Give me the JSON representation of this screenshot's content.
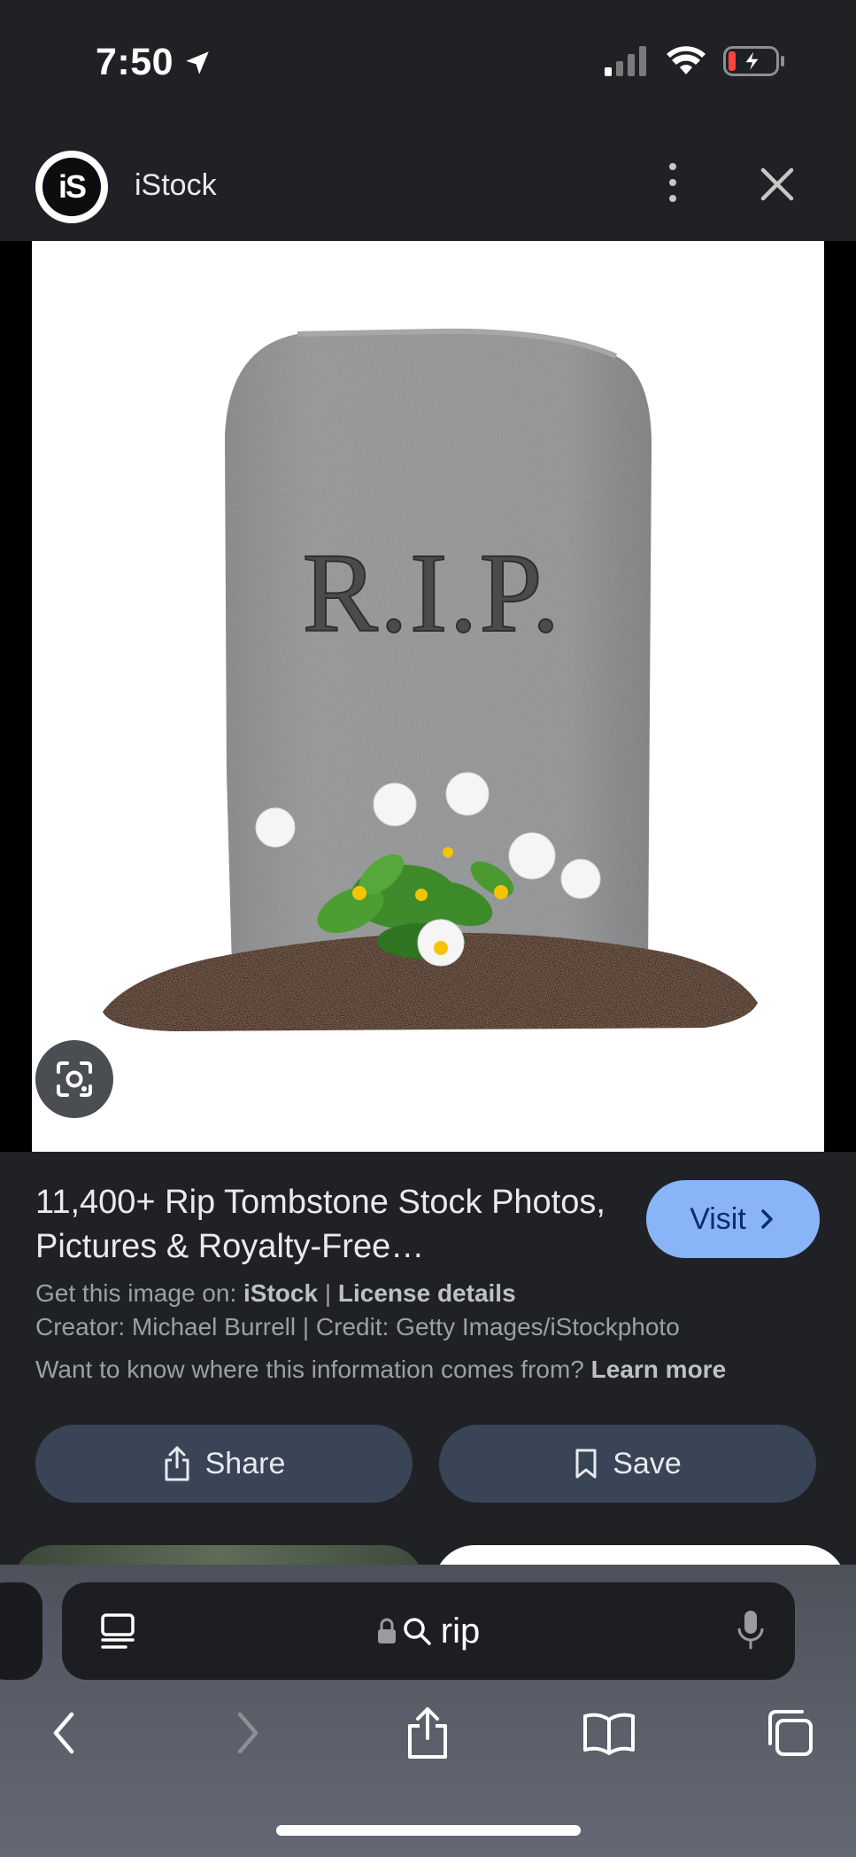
{
  "status_bar": {
    "time": "7:50",
    "battery_color": "#ff453a"
  },
  "header": {
    "logo_text": "iS",
    "site_name": "iStock"
  },
  "image": {
    "engraving": "R.I.P."
  },
  "result": {
    "title": "11,400+ Rip Tombstone Stock Photos, Pictures & Royalty-Free…",
    "visit_label": "Visit",
    "get_image_prefix": "Get this image on: ",
    "get_image_source": "iStock",
    "separator": " | ",
    "license_label": "License details",
    "creator_line": "Creator: Michael Burrell | Credit: Getty Images/iStockphoto",
    "info_question": "Want to know where this information comes from? ",
    "learn_more": "Learn more",
    "share_label": "Share",
    "save_label": "Save"
  },
  "browser": {
    "address_text": "rip"
  },
  "colors": {
    "background": "#202124",
    "visit_button": "#8ab4f8",
    "action_button": "#394457"
  }
}
